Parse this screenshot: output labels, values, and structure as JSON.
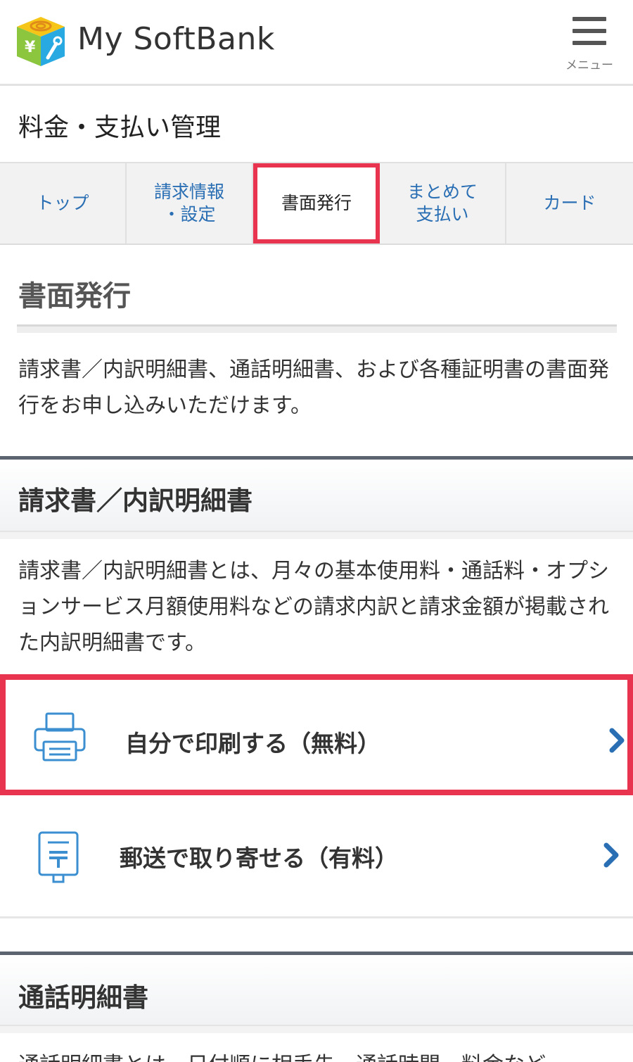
{
  "header": {
    "logo_text": "My SoftBank",
    "menu_label": "メニュー"
  },
  "page_title": "料金・支払い管理",
  "tabs": [
    {
      "label": "トップ",
      "active": false
    },
    {
      "label": "請求情報\n・設定",
      "active": false
    },
    {
      "label": "書面発行",
      "active": true
    },
    {
      "label": "まとめて\n支払い",
      "active": false
    },
    {
      "label": "カード",
      "active": false
    }
  ],
  "document": {
    "heading": "書面発行",
    "intro": "請求書／内訳明細書、通話明細書、および各種証明書の書面発行をお申し込みいただけます。"
  },
  "sections": [
    {
      "title": "請求書／内訳明細書",
      "description": "請求書／内訳明細書とは、月々の基本使用料・通話料・オプションサービス月額使用料などの請求内訳と請求金額が掲載された内訳明細書です。",
      "options": [
        {
          "label": "自分で印刷する（無料）",
          "icon": "printer-icon"
        },
        {
          "label": "郵送で取り寄せる（有料）",
          "icon": "postbox-icon"
        }
      ]
    },
    {
      "title": "通話明細書",
      "description_partial": "通話明細書とは、日付順に相手先、通話時間、料金など"
    }
  ],
  "colors": {
    "link_blue": "#2a6fb4",
    "highlight_red": "#e8344e",
    "icon_blue": "#3b8fd0",
    "band_border": "#5c6470"
  }
}
